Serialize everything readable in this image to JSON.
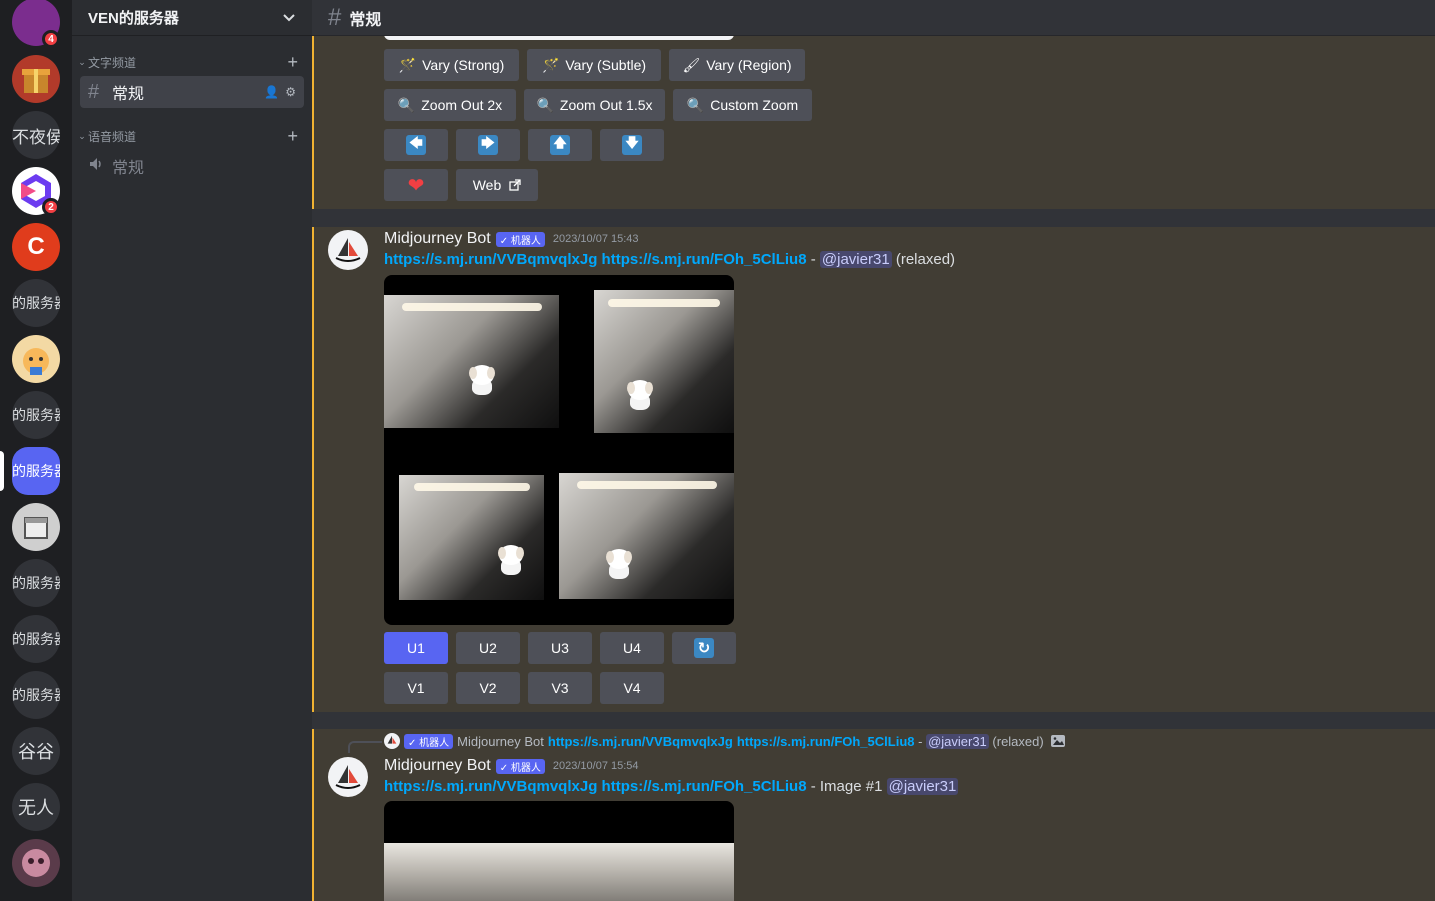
{
  "guilds": [
    {
      "label": "",
      "badge": "4",
      "color": "#7b2d8e"
    },
    {
      "label": "",
      "badge": "",
      "color": "#b23a2a"
    },
    {
      "label": "不夜侯",
      "badge": "",
      "color": "#313338"
    },
    {
      "label": "",
      "badge": "2",
      "color": "#ffffff"
    },
    {
      "label": "C",
      "badge": "",
      "color": "#e03c1c"
    },
    {
      "label": "的服务器",
      "badge": "",
      "color": "#313338"
    },
    {
      "label": "",
      "badge": "",
      "color": "#f3d9a4"
    },
    {
      "label": "的服务器",
      "badge": "",
      "color": "#313338"
    },
    {
      "label": "的服务器",
      "badge": "",
      "color": "#5865f2"
    },
    {
      "label": "",
      "badge": "",
      "color": "#cfcfcf"
    },
    {
      "label": "的服务器",
      "badge": "",
      "color": "#313338"
    },
    {
      "label": "的服务器",
      "badge": "",
      "color": "#313338"
    },
    {
      "label": "的服务器",
      "badge": "",
      "color": "#313338"
    },
    {
      "label": "谷谷",
      "badge": "",
      "color": "#313338"
    },
    {
      "label": "无人",
      "badge": "",
      "color": "#313338"
    },
    {
      "label": "",
      "badge": "",
      "color": "#5a3b4a"
    }
  ],
  "server": {
    "name": "VEN的服务器",
    "dropdown_icon": "chevron-down-icon"
  },
  "categories": {
    "text": "文字频道",
    "voice": "语音频道"
  },
  "channels": {
    "text_general": "常规",
    "voice_general": "常规"
  },
  "header": {
    "channel_name": "常规"
  },
  "top_buttons": {
    "vary_strong": "Vary (Strong)",
    "vary_subtle": "Vary (Subtle)",
    "vary_region": "Vary (Region)",
    "zoom_out_2x": "Zoom Out 2x",
    "zoom_out_15x": "Zoom Out 1.5x",
    "custom_zoom": "Custom Zoom",
    "arrow_left": "🡄",
    "arrow_right": "🡆",
    "arrow_up": "🡅",
    "arrow_down": "🡇",
    "heart": "❤",
    "web": "Web"
  },
  "message1": {
    "author": "Midjourney Bot",
    "bot_tag": "✓ 机器人",
    "timestamp": "2023/10/07 15:43",
    "link1": "https://s.mj.run/VVBqmvqlxJg",
    "link2": "https://s.mj.run/FOh_5ClLiu8",
    "sep": " - ",
    "mention": "@javier31",
    "suffix": " (relaxed)",
    "buttons_u": [
      "U1",
      "U2",
      "U3",
      "U4"
    ],
    "reroll": "↻",
    "buttons_v": [
      "V1",
      "V2",
      "V3",
      "V4"
    ]
  },
  "reply": {
    "bot_tag": "✓ 机器人",
    "author": "Midjourney Bot",
    "link1": "https://s.mj.run/VVBqmvqlxJg",
    "link2": "https://s.mj.run/FOh_5ClLiu8",
    "sep": " - ",
    "mention": "@javier31",
    "suffix": " (relaxed)"
  },
  "message2": {
    "author": "Midjourney Bot",
    "bot_tag": "✓ 机器人",
    "timestamp": "2023/10/07 15:54",
    "link1": "https://s.mj.run/VVBqmvqlxJg",
    "link2": "https://s.mj.run/FOh_5ClLiu8",
    "middle": " - Image #1 ",
    "mention": "@javier31"
  }
}
